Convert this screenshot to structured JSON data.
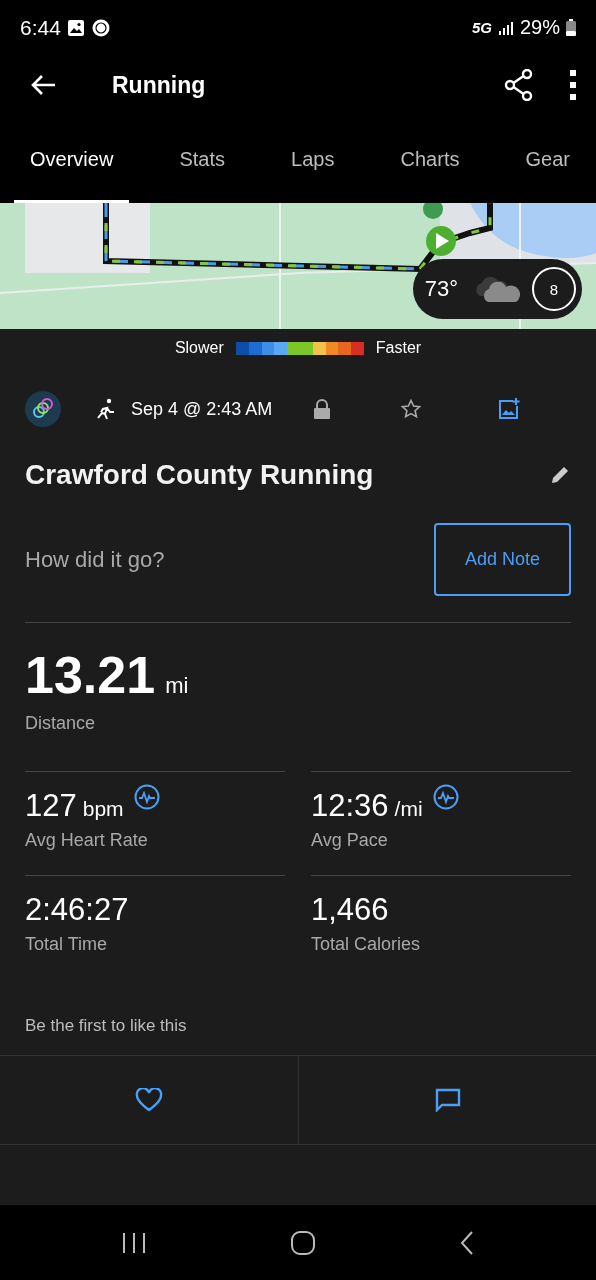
{
  "status_bar": {
    "time": "6:44",
    "network": "5G",
    "battery": "29%"
  },
  "app_bar": {
    "title": "Running"
  },
  "tabs": [
    {
      "label": "Overview",
      "selected": true
    },
    {
      "label": "Stats",
      "selected": false
    },
    {
      "label": "Laps",
      "selected": false
    },
    {
      "label": "Charts",
      "selected": false
    },
    {
      "label": "Gear",
      "selected": false
    }
  ],
  "map": {
    "kind": "picture",
    "weather": {
      "temperature": "73°",
      "wind": "8"
    }
  },
  "pace_legend": {
    "slower": "Slower",
    "faster": "Faster"
  },
  "activity": {
    "date": "Sep 4 @ 2:43 AM",
    "favorite": false,
    "title": "Crawford County Running"
  },
  "note": {
    "prompt": "How did it go?",
    "button": "Add Note"
  },
  "distance": {
    "value": "13.21",
    "unit": "mi",
    "label": "Distance"
  },
  "stats": [
    {
      "value": "127",
      "unit": "bpm",
      "label": "Avg Heart Rate",
      "chart_link": true
    },
    {
      "value": "12:36",
      "unit": "/mi",
      "label": "Avg Pace",
      "chart_link": true
    },
    {
      "value": "2:46:27",
      "label": "Total Time",
      "chart_link": false
    },
    {
      "value": "1,466",
      "label": "Total Calories",
      "chart_link": false
    }
  ],
  "social": {
    "likes_text": "Be the first to like this"
  }
}
